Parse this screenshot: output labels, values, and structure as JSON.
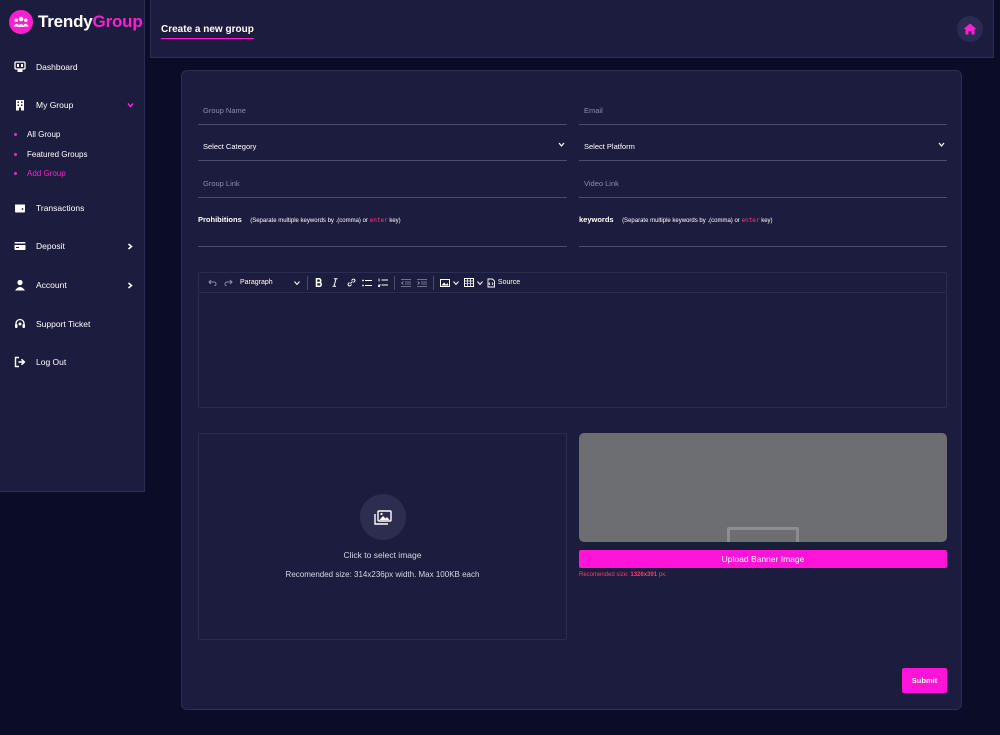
{
  "brand": {
    "name_part1": "Trendy",
    "name_part2": "Group",
    "accent_color": "#ff1fd0"
  },
  "sidebar": {
    "items": [
      {
        "label": "Dashboard",
        "icon": "dashboard-icon"
      },
      {
        "label": "My Group",
        "icon": "building-icon",
        "expanded": true
      },
      {
        "label": "Transactions",
        "icon": "wallet-icon"
      },
      {
        "label": "Deposit",
        "icon": "card-icon"
      },
      {
        "label": "Account",
        "icon": "user-icon"
      },
      {
        "label": "Support Ticket",
        "icon": "headset-icon"
      },
      {
        "label": "Log Out",
        "icon": "logout-icon"
      }
    ],
    "subitems": [
      {
        "label": "All Group"
      },
      {
        "label": "Featured Groups"
      },
      {
        "label": "Add Group",
        "active": true
      }
    ]
  },
  "header": {
    "title": "Create a new group",
    "home_icon": "home-icon"
  },
  "form": {
    "group_name_placeholder": "Group Name",
    "email_placeholder": "Email",
    "category_selected": "Select Category",
    "platform_selected": "Select Platform",
    "group_link_placeholder": "Group Link",
    "video_link_placeholder": "Video Link",
    "prohibitions_label": "Prohibitions",
    "prohibitions_hint_pre": "(Separate multiple keywords by",
    "prohibitions_hint_mid": ".(comma) or",
    "prohibitions_hint_enter": "enter",
    "prohibitions_hint_post": "key)",
    "keywords_label": "keywords",
    "keywords_hint_pre": "(Separate multiple keywords by",
    "keywords_hint_mid": ".(comma) or",
    "keywords_hint_enter": "enter",
    "keywords_hint_post": "key)"
  },
  "editor": {
    "paragraph_label": "Paragraph",
    "source_label": "Source"
  },
  "image_upload": {
    "click_text": "Click to select image",
    "recommended_text": "Recomended size: 314x236px width. Max 100KB each"
  },
  "banner": {
    "upload_label": "Upload Banner Image",
    "rec_prefix": "Recomended size:",
    "rec_size": "1326x391",
    "rec_suffix": "px."
  },
  "submit_label": "Submit"
}
